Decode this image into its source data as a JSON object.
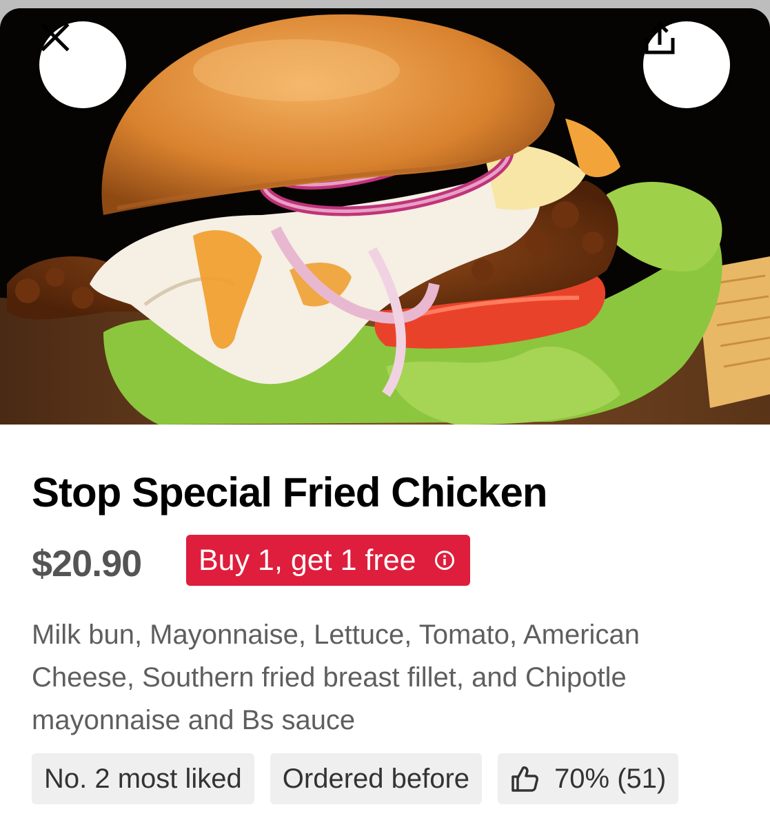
{
  "item": {
    "title": "Stop Special Fried Chicken",
    "price": "$20.90",
    "promo": {
      "label": "Buy 1, get 1 free",
      "icon": "info-icon",
      "color": "#de1e3c"
    },
    "description": "Milk bun, Mayonnaise, Lettuce, Tomato, American Cheese, Southern fried breast fillet, and Chipotle mayonnaise and Bs sauce",
    "image": "chicken-burger-photo"
  },
  "header": {
    "close_icon": "close-icon",
    "share_icon": "share-icon"
  },
  "tags": [
    {
      "label": "No. 2 most liked"
    },
    {
      "label": "Ordered before"
    },
    {
      "label": "70% (51)",
      "icon": "thumbs-up-icon"
    }
  ]
}
